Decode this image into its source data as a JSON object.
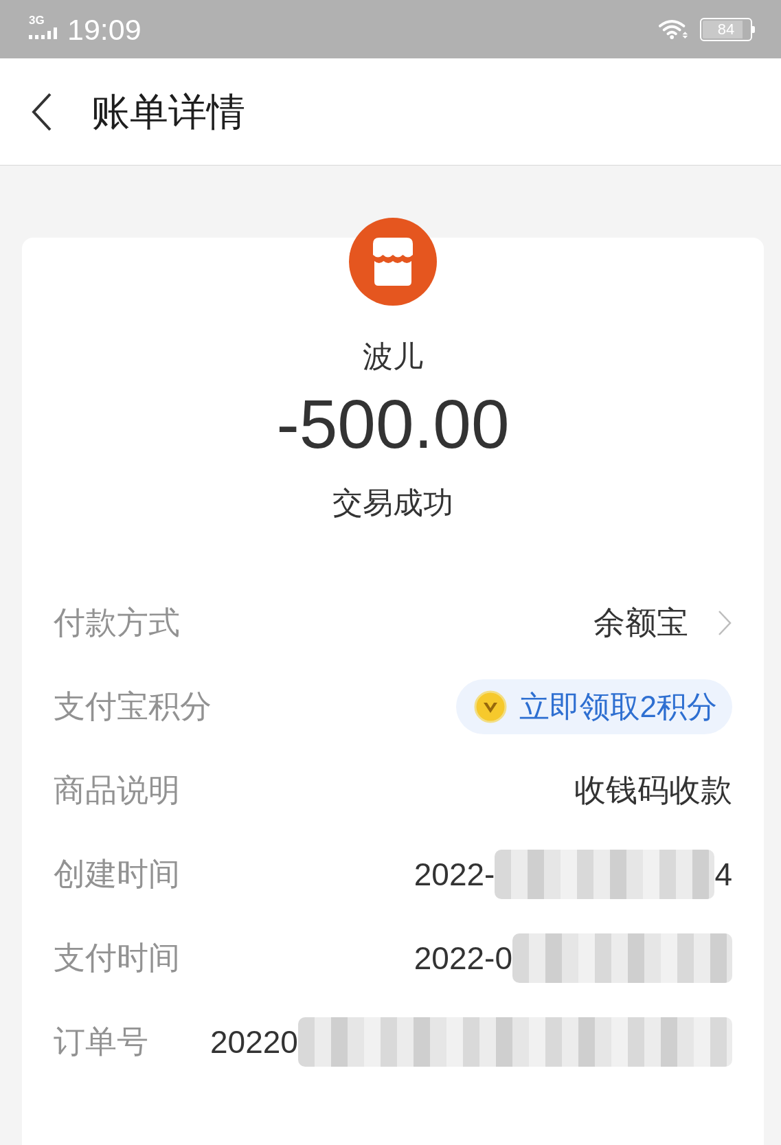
{
  "status_bar": {
    "network": "3G",
    "time": "19:09",
    "battery": "84"
  },
  "header": {
    "title": "账单详情"
  },
  "summary": {
    "merchant": "波儿",
    "amount": "-500.00",
    "status": "交易成功"
  },
  "details": [
    {
      "kind": "link",
      "label": "付款方式",
      "value": "余额宝"
    },
    {
      "kind": "points",
      "label": "支付宝积分",
      "action": "立即领取2积分"
    },
    {
      "kind": "text",
      "label": "商品说明",
      "value": "收钱码收款"
    },
    {
      "kind": "masked",
      "label": "创建时间",
      "segments": [
        {
          "kind": "text",
          "text": "2022-"
        },
        {
          "kind": "redacted"
        },
        {
          "kind": "text",
          "text": "4"
        }
      ]
    },
    {
      "kind": "masked",
      "label": "支付时间",
      "segments": [
        {
          "kind": "text",
          "text": "2022-0"
        },
        {
          "kind": "redacted"
        }
      ]
    },
    {
      "kind": "masked",
      "label": "订单号",
      "segments": [
        {
          "kind": "text",
          "text": "20220"
        },
        {
          "kind": "redacted"
        }
      ]
    }
  ]
}
